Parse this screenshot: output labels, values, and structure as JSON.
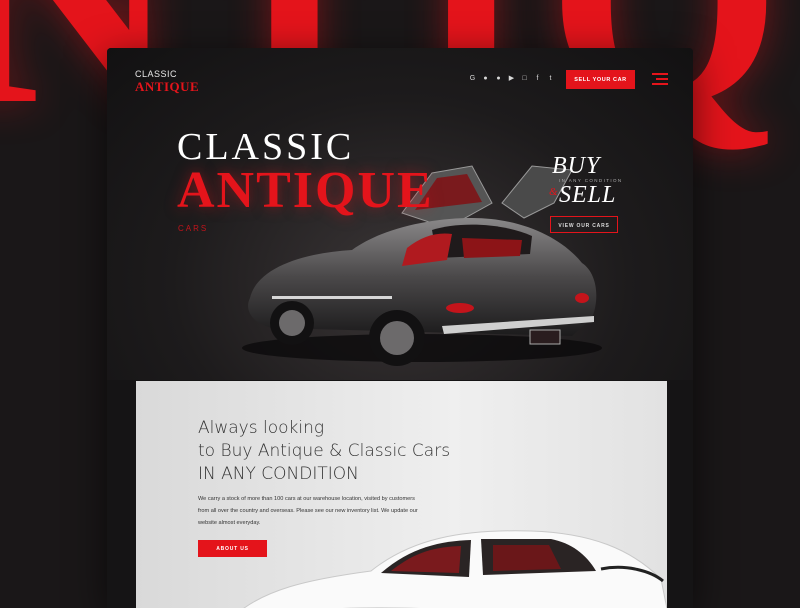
{
  "background_text": "NTIQ",
  "header": {
    "logo_top": "CLASSIC",
    "logo_bottom": "ANTIQUE",
    "social_icons": [
      "google-plus-icon",
      "pinterest-icon",
      "telegram-icon",
      "youtube-icon",
      "instagram-icon",
      "facebook-icon",
      "twitter-icon"
    ],
    "sell_button": "SELL YOUR CAR"
  },
  "hero": {
    "title_line1": "CLASSIC",
    "title_line2": "ANTIQUE",
    "subtitle": "CARS",
    "buy": "BUY",
    "in_any_condition": "IN ANY CONDITION",
    "ampersand": "&",
    "sell": "SELL",
    "view_button": "VIEW OUR CARS"
  },
  "section2": {
    "heading_lines": [
      "Always looking",
      "to Buy Antique & Classic Cars",
      "IN ANY CONDITION"
    ],
    "paragraph_lines": [
      "We carry a stock of more than 100 cars at our warehouse location, visited by customers",
      "from all over the country and overseas. Please see our new inventory list. We update our",
      "website almost everyday."
    ],
    "about_button": "ABOUT US"
  },
  "colors": {
    "accent": "#e4141b",
    "dark_bg": "#1a1718",
    "card_bg": "#151415"
  }
}
